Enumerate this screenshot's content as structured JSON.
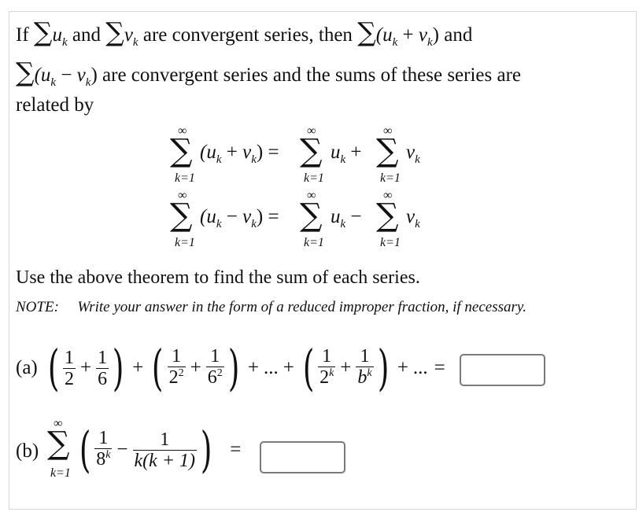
{
  "intro": {
    "line1": {
      "if": "If",
      "sum_u": "u",
      "and1": "and",
      "sum_v": "v",
      "middle": "are convergent series, then",
      "expr_plus": "(u",
      "plus": "+",
      "v": "v",
      "close": ")",
      "and2": "and"
    },
    "line2": {
      "expr_minus": "(u",
      "minus": "−",
      "v": "v",
      "close": ")",
      "rest": "are convergent series and the sums of these series are"
    },
    "line3": "related by",
    "subscript": "k"
  },
  "theorem": {
    "upper_limit": "∞",
    "lower_limit": "k=1",
    "row1": {
      "lhs": "(u",
      "op": "+",
      "v": "v",
      "close": ")",
      "eq": "=",
      "u": "u",
      "rhs_op": "+",
      "v2": "v"
    },
    "row2": {
      "lhs": "(u",
      "op": "−",
      "v": "v",
      "close": ")",
      "eq": "=",
      "u": "u",
      "rhs_op": "−",
      "v2": "v"
    }
  },
  "instruction": "Use the above theorem to find the sum of each series.",
  "note": {
    "label": "NOTE:",
    "text": "Write your answer in the form of a reduced improper fraction, if necessary."
  },
  "part_a": {
    "label": "(a)",
    "terms": [
      {
        "n1": "1",
        "d1": "2",
        "e1": "",
        "n2": "1",
        "d2": "6",
        "e2": ""
      },
      {
        "n1": "1",
        "d1": "2",
        "e1": "2",
        "n2": "1",
        "d2": "6",
        "e2": "2"
      },
      {
        "n1": "1",
        "d1": "2",
        "e1": "k",
        "n2": "1",
        "d2": "b",
        "e2": "k"
      }
    ],
    "plus": "+",
    "ellipsis": "...",
    "equals": "=",
    "answer_value": ""
  },
  "part_b": {
    "label": "(b)",
    "upper_limit": "∞",
    "lower_limit": "k=1",
    "n1": "1",
    "d1": "8",
    "e1": "k",
    "minus": "−",
    "n2": "1",
    "d2": "k(k + 1)",
    "equals": "=",
    "answer_value": ""
  }
}
